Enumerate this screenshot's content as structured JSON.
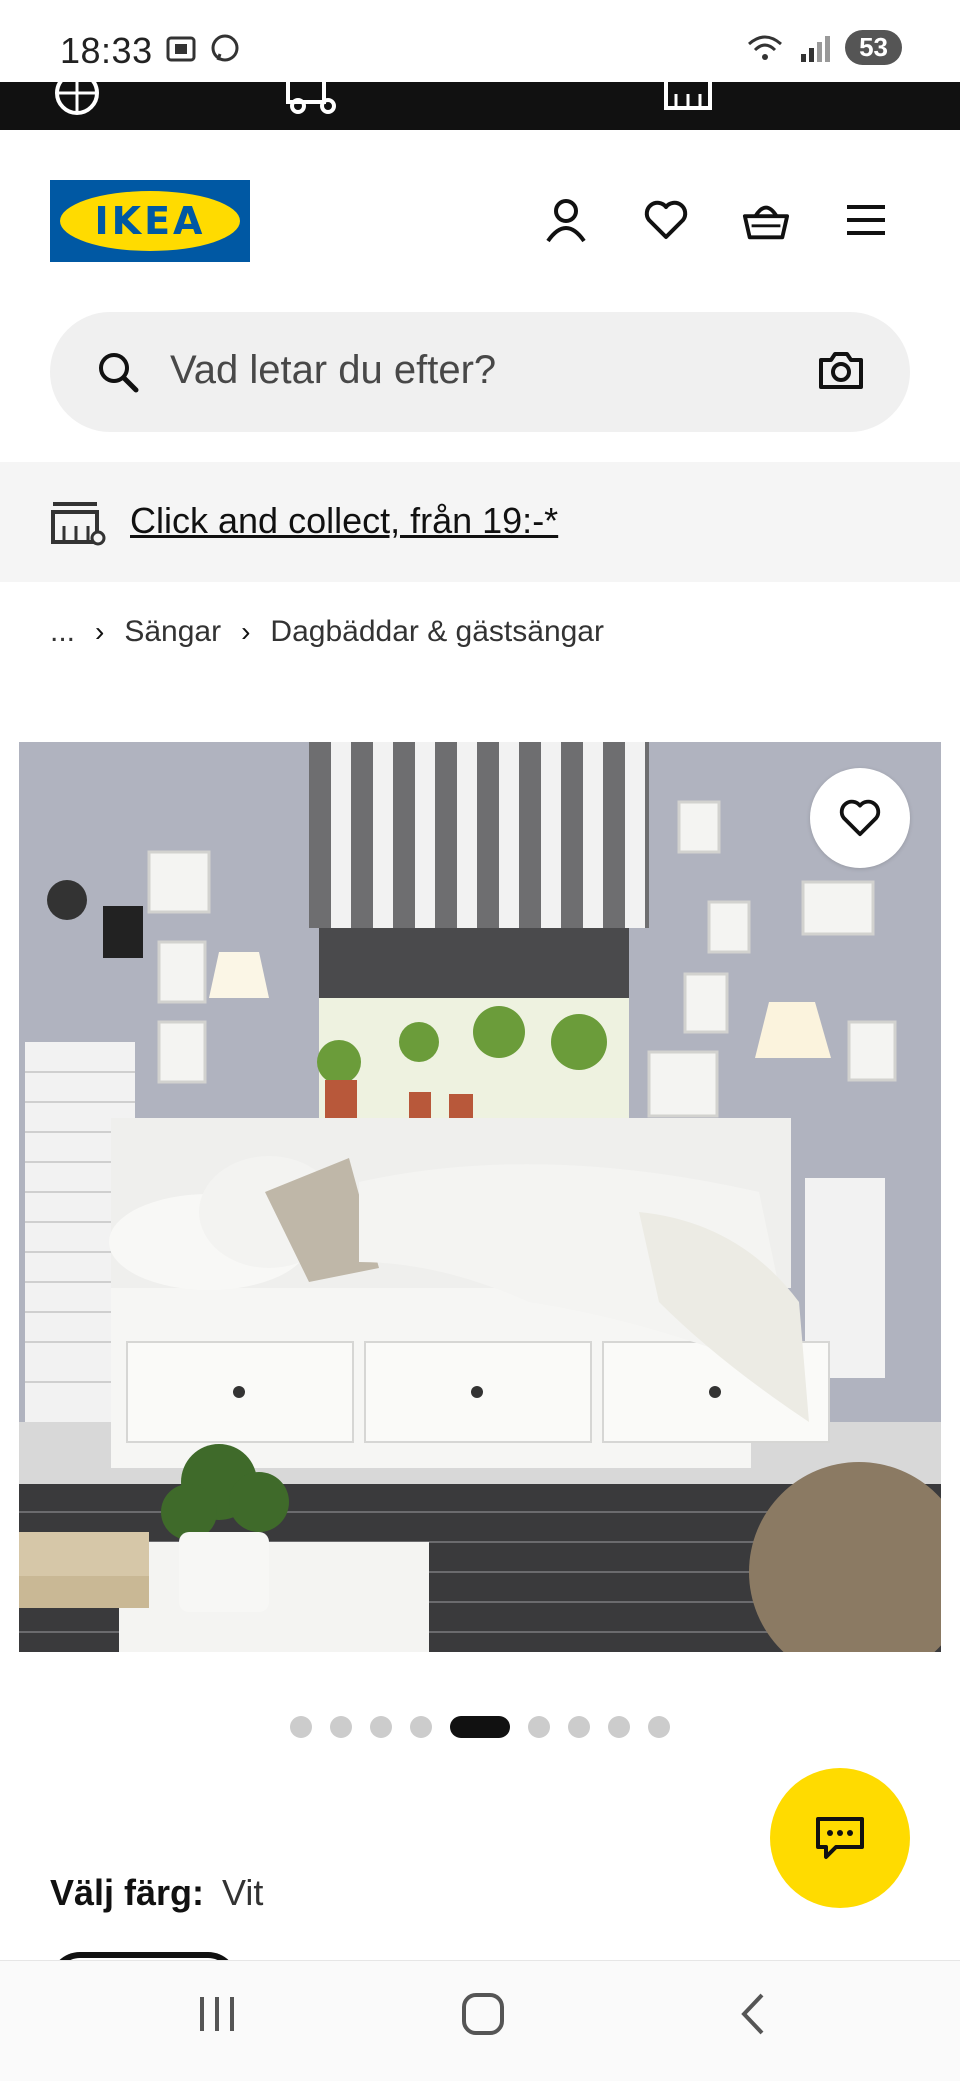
{
  "status_bar": {
    "time": "18:33",
    "battery": "53"
  },
  "header": {
    "logo_text": "IKEA"
  },
  "search": {
    "placeholder": "Vad letar du efter?"
  },
  "collect_banner": {
    "text": "Click and collect, från 19:-*"
  },
  "breadcrumb": {
    "ellipsis": "...",
    "items": [
      "Sängar",
      "Dagbäddar & gästsängar"
    ]
  },
  "gallery": {
    "total_dots": 9,
    "active_index": 4
  },
  "color_picker": {
    "label": "Välj färg:",
    "value": "Vit"
  },
  "colors": {
    "ikea_blue": "#0058a3",
    "ikea_yellow": "#ffdb00",
    "text_dark": "#111111",
    "search_bg": "#f0f0f0"
  },
  "icons": {
    "account": "person-icon",
    "wishlist": "heart-icon",
    "cart": "basket-icon",
    "menu": "hamburger-menu-icon",
    "search": "magnifier-icon",
    "visual_search": "camera-icon",
    "store": "store-icon",
    "chat": "chat-icon"
  }
}
